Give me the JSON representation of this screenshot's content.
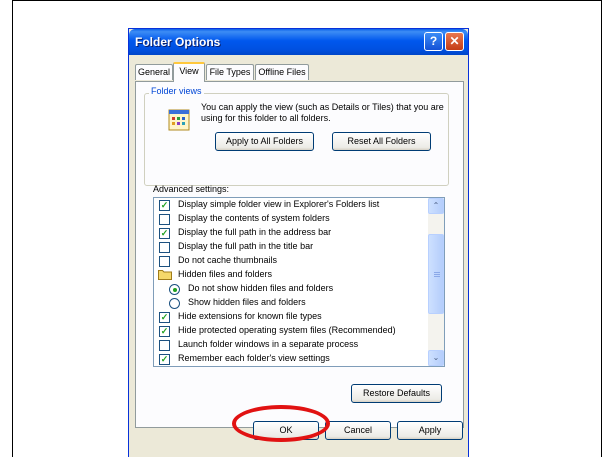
{
  "dialog": {
    "title": "Folder Options",
    "help_glyph": "?",
    "close_glyph": "✕"
  },
  "tabs": [
    {
      "label": "General"
    },
    {
      "label": "View"
    },
    {
      "label": "File Types"
    },
    {
      "label": "Offline Files"
    }
  ],
  "folder_views": {
    "label": "Folder views",
    "description": "You can apply the view (such as Details or Tiles) that you are using for this folder to all folders.",
    "apply_label": "Apply to All Folders",
    "reset_label": "Reset All Folders"
  },
  "advanced": {
    "label": "Advanced settings:",
    "items": [
      {
        "label": "Display simple folder view in Explorer's Folders list",
        "kind": "checkbox",
        "checked": true
      },
      {
        "label": "Display the contents of system folders",
        "kind": "checkbox",
        "checked": false
      },
      {
        "label": "Display the full path in the address bar",
        "kind": "checkbox",
        "checked": true
      },
      {
        "label": "Display the full path in the title bar",
        "kind": "checkbox",
        "checked": false
      },
      {
        "label": "Do not cache thumbnails",
        "kind": "checkbox",
        "checked": false
      },
      {
        "label": "Hidden files and folders",
        "kind": "folder"
      },
      {
        "label": "Do not show hidden files and folders",
        "kind": "radio",
        "checked": true
      },
      {
        "label": "Show hidden files and folders",
        "kind": "radio",
        "checked": false
      },
      {
        "label": "Hide extensions for known file types",
        "kind": "checkbox",
        "checked": true
      },
      {
        "label": "Hide protected operating system files (Recommended)",
        "kind": "checkbox",
        "checked": true
      },
      {
        "label": "Launch folder windows in a separate process",
        "kind": "checkbox",
        "checked": false
      },
      {
        "label": "Remember each folder's view settings",
        "kind": "checkbox",
        "checked": true
      }
    ],
    "scroll_up_glyph": "⌃",
    "scroll_down_glyph": "⌄"
  },
  "buttons": {
    "restore_defaults": "Restore Defaults",
    "ok": "OK",
    "cancel": "Cancel",
    "apply": "Apply"
  },
  "check_glyph": "✓",
  "colors": {
    "title_blue": "#0058ee",
    "dialog_face": "#ece9d8",
    "highlight_red": "#e11212",
    "check_green": "#21a121"
  }
}
